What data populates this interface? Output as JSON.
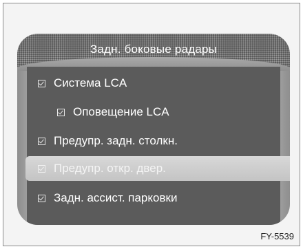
{
  "menu": {
    "title": "Задн. боковые радары",
    "items": [
      {
        "label": "Система LCA",
        "checked": true,
        "indent": 0,
        "selected": false
      },
      {
        "label": "Оповещение LCA",
        "checked": true,
        "indent": 1,
        "selected": false
      },
      {
        "label": "Предупр. задн. столкн.",
        "checked": true,
        "indent": 0,
        "selected": false
      },
      {
        "label": "Предупр. откр. двер.",
        "checked": true,
        "indent": 0,
        "selected": true
      },
      {
        "label": "Задн. ассист. парковки",
        "checked": true,
        "indent": 0,
        "selected": false
      }
    ]
  },
  "figure_code": "FY-5539"
}
